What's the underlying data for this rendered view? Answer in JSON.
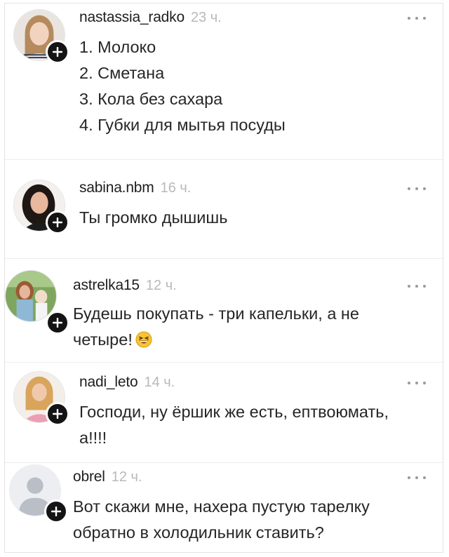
{
  "comments": [
    {
      "username": "nastassia_radko",
      "time": "23 ч.",
      "list": [
        "1. Молоко",
        "2. Сметана",
        "3. Кола без сахара",
        "4. Губки для мытья посуды"
      ]
    },
    {
      "username": "sabina.nbm",
      "time": "16 ч.",
      "lines": [
        "Ты громко дышишь"
      ]
    },
    {
      "username": "astrelka15",
      "time": "12 ч.",
      "lines": [
        "Будешь покупать - три капельки, а не",
        "четыре!"
      ],
      "emoji": "grinning-squinting-face-emoji"
    },
    {
      "username": "nadi_leto",
      "time": "14 ч.",
      "lines": [
        "Господи, ну ёршик же есть, ептвоюмать,",
        "а!!!!"
      ]
    },
    {
      "username": "obrel",
      "time": "12 ч.",
      "lines": [
        "Вот скажи мне, нахера пустую тарелку",
        "обратно в холодильник ставить?"
      ]
    }
  ],
  "icons": {
    "more": "more-horizontal-icon",
    "follow": "plus-icon",
    "default_avatar": "default-user-avatar-icon"
  },
  "colors": {
    "text": "#262626",
    "muted": "#b9b9b9",
    "plus_badge": "#141414",
    "divider": "#ededed"
  }
}
